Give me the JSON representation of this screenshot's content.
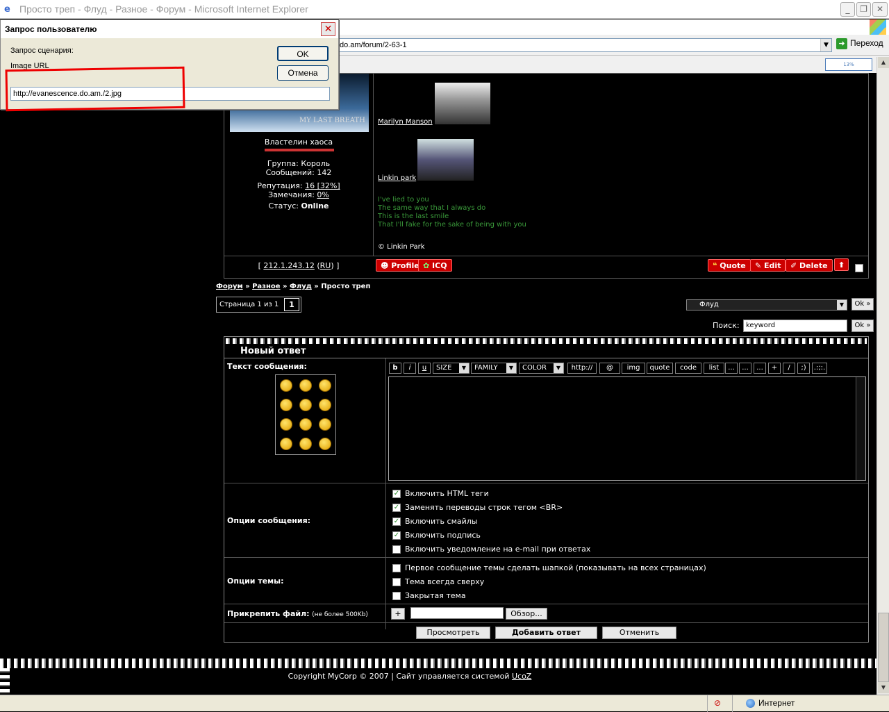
{
  "window": {
    "title": "Просто треп - Флуд - Разное - Форум - Microsoft Internet Explorer"
  },
  "address": {
    "url": "do.am/forum/2-63-1",
    "go_label": "Переход"
  },
  "dialog": {
    "title": "Запрос пользователю",
    "prompt_label": "Запрос сценария:",
    "field_label": "Image URL",
    "input_value": "http://evanescence.do.am./2.jpg",
    "ok_label": "OK",
    "cancel_label": "Отмена"
  },
  "post": {
    "banner_text": "MY LAST BREATH",
    "user_title": "Властелин хаоса",
    "group": "Группа: Король",
    "messages": "Сообщений: 142",
    "reputation_label": "Репутация:",
    "reputation_value": "16 [32%]",
    "warnings_label": "Замечания:",
    "warnings_value": "0%",
    "status_label": "Статус:",
    "status_value": "Online",
    "ip_prefix": "[",
    "ip": "212.1.243.12",
    "ip_region": "RU",
    "ip_suffix": "]",
    "links": [
      "Marilyn Manson",
      "Linkin park"
    ],
    "lyrics": [
      "I've lied to you",
      "The same way that I always do",
      "This is the last smile",
      "That I'll fake for the sake of being with you"
    ],
    "credit": "© Linkin Park",
    "buttons": {
      "profile": "Profile",
      "icq": "ICQ",
      "quote": "Quote",
      "edit": "Edit",
      "delete": "Delete"
    }
  },
  "breadcrumb": {
    "forum": "Форум",
    "sep": "»",
    "section": "Разное",
    "subsection": "Флуд",
    "current": "Просто треп"
  },
  "pager": {
    "label": "Страница 1 из 1",
    "current": "1"
  },
  "jump": {
    "selected": "Флуд",
    "ok": "Ok »"
  },
  "search": {
    "label": "Поиск:",
    "value": "keyword",
    "ok": "Ok »"
  },
  "reply": {
    "header": "Новый ответ",
    "message_label": "Текст сообщения:",
    "toolbar": [
      "b",
      "i",
      "u"
    ],
    "size_label": "SIZE",
    "family_label": "FAMILY",
    "color_label": "COLOR",
    "toolbar2": [
      "http://",
      "@",
      "img",
      "quote",
      "code",
      "list",
      "...",
      "...",
      "...",
      "+",
      "/",
      ";)",
      ".:;:."
    ],
    "options_label": "Опции сообщения:",
    "options": [
      {
        "label": "Включить HTML теги",
        "checked": true
      },
      {
        "label": "Заменять переводы строк тегом <BR>",
        "checked": true
      },
      {
        "label": "Включить смайлы",
        "checked": true
      },
      {
        "label": "Включить подпись",
        "checked": true
      },
      {
        "label": "Включить уведомление на e-mail при ответах",
        "checked": false
      }
    ],
    "topic_label": "Опции темы:",
    "topic_options": [
      {
        "label": "Первое сообщение темы сделать шапкой (показывать на всех страницах)",
        "checked": false
      },
      {
        "label": "Тема всегда сверху",
        "checked": false
      },
      {
        "label": "Закрытая тема",
        "checked": false
      }
    ],
    "attach_label": "Прикрепить файл:",
    "attach_note": "(не более 500Kb)",
    "attach_plus": "+",
    "browse": "Обзор...",
    "preview": "Просмотреть",
    "submit": "Добавить ответ",
    "cancel": "Отменить"
  },
  "footer": {
    "copyright": "Copyright MyCorp © 2007 | Сайт управляется системой",
    "ucoz": "UcoZ"
  },
  "statusbar": {
    "zone": "Интернет"
  },
  "colors": {
    "lyrics": "#3a9a3a",
    "red_action": "#cc0000"
  }
}
